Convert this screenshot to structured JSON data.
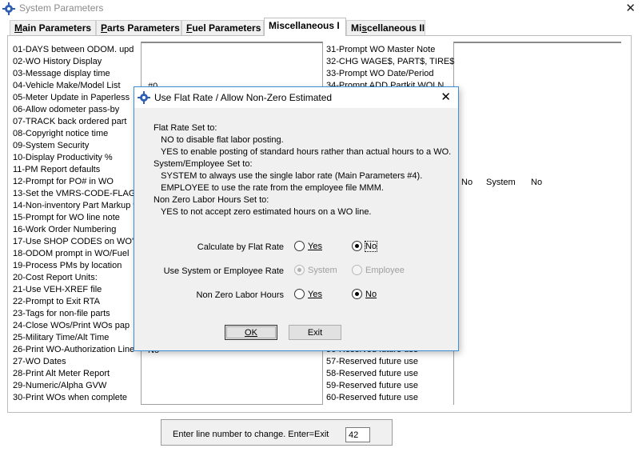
{
  "window": {
    "title": "System Parameters",
    "icon": "gear-app-icon",
    "close_glyph": "✕"
  },
  "tabs": [
    {
      "label": "Main Parameters",
      "ul": "M",
      "rest": "ain Parameters",
      "active": false
    },
    {
      "label": "Parts Parameters",
      "ul": "P",
      "rest": "arts Parameters",
      "active": false
    },
    {
      "label": "Fuel Parameters",
      "ul": "F",
      "rest": "uel Parameters",
      "active": false
    },
    {
      "label": "Miscellaneous I",
      "active": true
    },
    {
      "label": "Miscellaneous II",
      "pre": "Mi",
      "ul": "s",
      "rest": "cellaneous II",
      "active": false
    }
  ],
  "left_params": [
    "01-DAYS between ODOM. upd",
    "02-WO History Display",
    "03-Message display time",
    "04-Vehicle Make/Model List",
    "05-Meter Update in Paperless",
    "06-Allow odometer pass-by",
    "07-TRACK back ordered part",
    "08-Copyright notice time",
    "09-System Security",
    "10-Display Productivity %",
    "11-PM Report defaults",
    "12-Prompt for PO# in WO",
    "13-Set the VMRS-CODE-FLAG",
    "14-Non-inventory Part Markup %",
    "15-Prompt for WO line note",
    "16-Work Order Numbering",
    "17-Use SHOP CODES on WO's",
    "18-ODOM prompt in WO/Fuel",
    "19-Process PMs by location",
    "20-Cost Report Units:",
    "21-Use VEH-XREF file",
    "22-Prompt to Exit RTA",
    "23-Tags for non-file parts",
    "24-Close WOs/Print WOs pap",
    "25-Military Time/Alt Time",
    "26-Print WO-Authorization Line",
    "27-WO Dates",
    "28-Print Alt Meter Report",
    "29-Numeric/Alpha GVW",
    "30-Print WOs when complete"
  ],
  "right_params": [
    "31-Prompt WO Master Note",
    "32-CHG WAGE$, PART$, TIRE$",
    "33-Prompt WO Date/Period",
    "34-Prompt ADD Partkit WOLN",
    "",
    "",
    "",
    "",
    "",
    "",
    "",
    "",
    "",
    "",
    "",
    "",
    "",
    "",
    "",
    "",
    "",
    "",
    "",
    "",
    "",
    "56-Reserved future use",
    "57-Reserved future use",
    "58-Reserved future use",
    "59-Reserved future use",
    "60-Reserved future use"
  ],
  "values": {
    "row4_value": "#0",
    "row26_value": "No",
    "row12_a": "No",
    "row12_b": "System",
    "row12_c": "No"
  },
  "prompt": {
    "label": "Enter line number to change. Enter=Exit",
    "value": "42"
  },
  "dialog": {
    "title": "Use Flat Rate / Allow Non-Zero Estimated",
    "info_lines": [
      "Flat Rate Set to:",
      "   NO to disable flat labor posting.",
      "   YES to enable posting of standard hours rather than actual hours to a WO.",
      "System/Employee Set to:",
      "   SYSTEM to always use the single labor rate (Main Parameters #4).",
      "   EMPLOYEE to use the rate from the employee file MMM.",
      "Non Zero Labor Hours Set to:",
      "   YES to not accept zero estimated hours on a WO line."
    ],
    "options": [
      {
        "label": "Calculate by Flat Rate",
        "a": "Yes",
        "b": "No",
        "selected": "b",
        "disabled": false
      },
      {
        "label": "Use System or Employee Rate",
        "a": "System",
        "b": "Employee",
        "selected": "a",
        "disabled": true
      },
      {
        "label": "Non Zero Labor Hours",
        "a": "Yes",
        "b": "No",
        "selected": "b",
        "disabled": false
      }
    ],
    "ok_label": "OK",
    "exit_label": "Exit"
  },
  "colors": {
    "dialog_border": "#3c8fd6",
    "panel_bg": "#ffffff",
    "dialog_bg": "#f0f0f0"
  }
}
